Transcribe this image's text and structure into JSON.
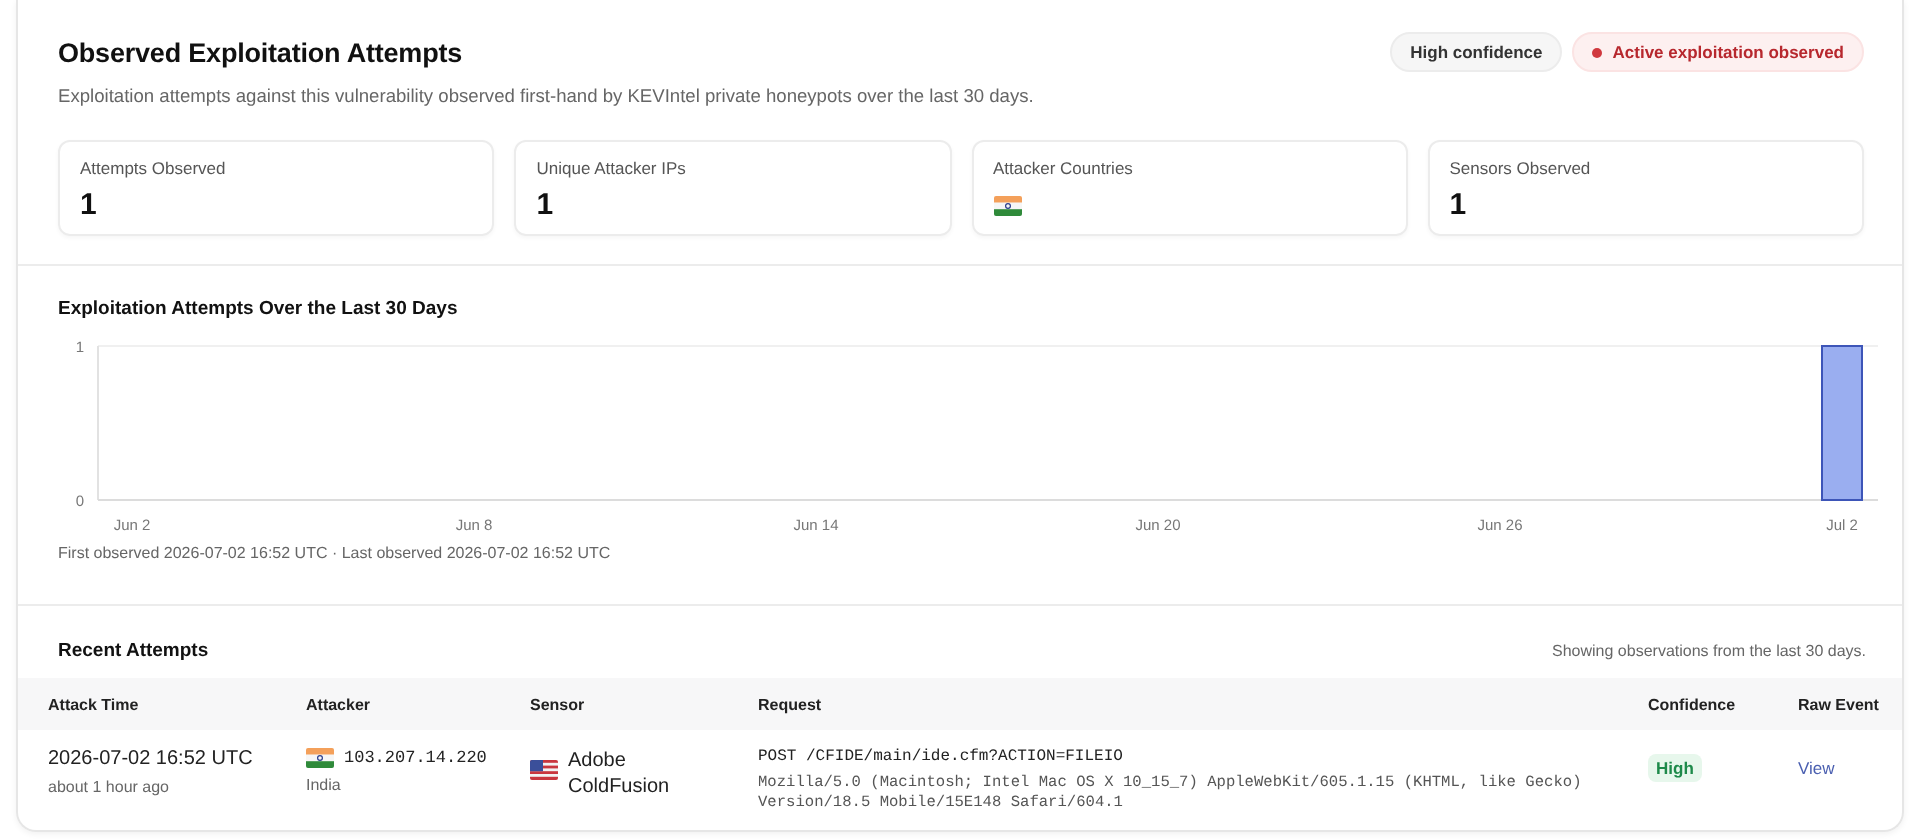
{
  "header": {
    "title": "Observed Exploitation Attempts",
    "description": "Exploitation attempts against this vulnerability observed first-hand by KEVIntel private honeypots over the last 30 days.",
    "badges": [
      {
        "kind": "neutral",
        "label": "High confidence"
      },
      {
        "kind": "alert",
        "label": "Active exploitation observed"
      }
    ]
  },
  "stats": [
    {
      "kind": "number",
      "label": "Attempts Observed",
      "value": "1"
    },
    {
      "kind": "number",
      "label": "Unique Attacker IPs",
      "value": "1"
    },
    {
      "kind": "flags",
      "label": "Attacker Countries",
      "flags": [
        {
          "kind": "india"
        }
      ]
    },
    {
      "kind": "number",
      "label": "Sensors Observed",
      "value": "1"
    }
  ],
  "chart": {
    "chart_data": {
      "type": "bar",
      "title": "Exploitation Attempts Over the Last 30 Days",
      "categories": [
        "Jun 2",
        null,
        null,
        null,
        null,
        null,
        "Jun 8",
        null,
        null,
        null,
        null,
        null,
        "Jun 14",
        null,
        null,
        null,
        null,
        null,
        "Jun 20",
        null,
        null,
        null,
        null,
        null,
        "Jun 26",
        null,
        null,
        null,
        null,
        null,
        "Jul 2"
      ],
      "values": [
        0,
        0,
        0,
        0,
        0,
        0,
        0,
        0,
        0,
        0,
        0,
        0,
        0,
        0,
        0,
        0,
        0,
        0,
        0,
        0,
        0,
        0,
        0,
        0,
        0,
        0,
        0,
        0,
        0,
        0,
        1
      ],
      "ylim": [
        0,
        1
      ],
      "yticks": [
        0,
        1
      ]
    },
    "footer": "First observed 2026-07-02 16:52 UTC · Last observed 2026-07-02 16:52 UTC"
  },
  "recent": {
    "title": "Recent Attempts",
    "note": "Showing observations from the last 30 days.",
    "columns": [
      "Attack Time",
      "Attacker",
      "Sensor",
      "Request",
      "Confidence",
      "Raw Event"
    ],
    "rows": [
      {
        "attack_time": "2026-07-02 16:52 UTC",
        "relative_time": "about 1 hour ago",
        "attacker_flag": {
          "kind": "india"
        },
        "attacker_ip": "103.207.14.220",
        "attacker_country": "India",
        "sensor_flag": {
          "kind": "usa"
        },
        "sensor": "Adobe ColdFusion",
        "request_line": "POST /CFIDE/main/ide.cfm?ACTION=FILEIO",
        "user_agent": "Mozilla/5.0 (Macintosh; Intel Mac OS X 10_15_7) AppleWebKit/605.1.15 (KHTML, like Gecko) Version/18.5 Mobile/15E148 Safari/604.1",
        "confidence": "High",
        "raw_event": "View"
      }
    ]
  }
}
